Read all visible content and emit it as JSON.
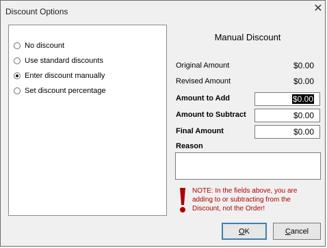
{
  "window": {
    "title": "Discount Options",
    "close_symbol": "✕"
  },
  "options": [
    {
      "label": "No discount",
      "selected": false
    },
    {
      "label": "Use standard discounts",
      "selected": false
    },
    {
      "label": "Enter discount manually",
      "selected": true
    },
    {
      "label": "Set discount percentage",
      "selected": false
    }
  ],
  "manual": {
    "heading": "Manual Discount",
    "original_label": "Original Amount",
    "original_value": "$0.00",
    "revised_label": "Revised Amount",
    "revised_value": "$0.00",
    "add_label": "Amount to Add",
    "add_value": "$0.00",
    "subtract_label": "Amount to Subtract",
    "subtract_value": "$0.00",
    "final_label": "Final Amount",
    "final_value": "$0.00",
    "reason_label": "Reason",
    "reason_value": ""
  },
  "note": "NOTE: In the fields above, you are adding to or subtracting from the Discount, not the Order!",
  "buttons": {
    "ok_mnemonic": "O",
    "ok_rest": "K",
    "cancel_mnemonic": "C",
    "cancel_rest": "ancel"
  },
  "colors": {
    "note_red": "#b00000",
    "default_button_border": "#3c7fb1"
  }
}
